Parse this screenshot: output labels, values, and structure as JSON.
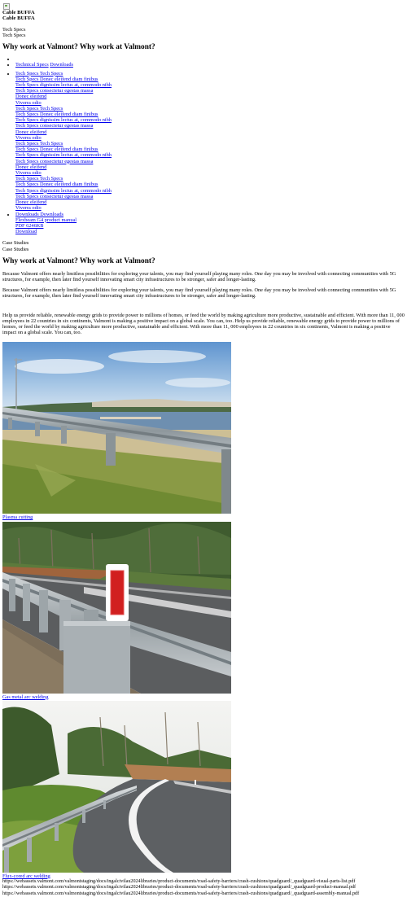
{
  "logo_icon": "broken-image-icon",
  "product": {
    "title_a": "Cable BUFFA",
    "title_b": "Cable BUFFA"
  },
  "tech_specs_heading": {
    "a": "Tech Specs",
    "b": "Tech Specs"
  },
  "section1": {
    "heading": "Why work at Valmont? Why work at Valmont?"
  },
  "tabs": [
    {
      "label": "Technical Specs"
    },
    {
      "label": "Downloads"
    }
  ],
  "spec_groups": [
    {
      "title": "Tech Specs Tech Specs",
      "items": [
        "Tech Specs Donec eleifend diam finibus",
        "Tech Specs dignissim lectus at, commodo nibh",
        "Tech Specs consectetur egestas massa",
        "Donec eleifend",
        "Viverra odio"
      ]
    },
    {
      "title": "Tech Specs Tech Specs",
      "items": [
        "Tech Specs Donec eleifend diam finibus",
        "Tech Specs dignissim lectus at, commodo nibh",
        "Tech Specs consectetur egestas massa",
        "Donec eleifend",
        "Viverra odio"
      ]
    },
    {
      "title": "Tech Specs Tech Specs",
      "items": [
        "Tech Specs Donec eleifend diam finibus",
        "Tech Specs dignissim lectus at, commodo nibh",
        "Tech Specs consectetur egestas massa",
        "Donec eleifend",
        "Viverra odio"
      ]
    },
    {
      "title": "Tech Specs Tech Specs",
      "items": [
        "Tech Specs Donec eleifend diam finibus",
        "Tech Specs dignissim lectus at, commodo nibh",
        "Tech Specs consectetur egestas massa",
        "Donec eleifend",
        "Viverra odio"
      ]
    }
  ],
  "downloads": {
    "title": "Downloads Downloads",
    "file_name": "Flexbeam G4 product manual",
    "file_meta": "PDF 6246KB",
    "action": "Download"
  },
  "case_studies": {
    "a": "Case Studies",
    "b": "Case Studies"
  },
  "section2": {
    "heading": "Why work at Valmont? Why work at Valmont?",
    "paragraph_1": "Because Valmont offers nearly limitless possibilities for exploring your talents, you may find yourself playing many roles. One day you may be involved with connecting communities with 5G structures, for example, then later find yourself innovating smart city infrastructures to be stronger, safer and longer-lasting.",
    "paragraph_2": "Because Valmont offers nearly limitless possibilities for exploring your talents, you may find yourself playing many roles. One day you may be involved with connecting communities with 5G structures, for example, then later find yourself innovating smart city infrastructures to be stronger, safer and longer-lasting.",
    "paragraph_3": "Help us provide reliable, renewable energy grids to provide power to millions of homes, or feed the world by making agriculture more productive, sustainable and efficient. With more than 11, 000 employees in 22 countries in six continents, Valmont is making a positive impact on a global scale. You can, too. Help us provide reliable, renewable energy grids to provide power to millions of homes, or feed the world by making agriculture more productive, sustainable and efficient. With more than 11, 000 employees in 22 countries in six continents, Valmont is making a positive impact on a global scale. You can, too."
  },
  "gallery": [
    {
      "caption": "Plasma cutting",
      "scene": "guardrail-coastal-road"
    },
    {
      "caption": "Gas metal arc welding",
      "scene": "guardrail-end-terminal-red-marker"
    },
    {
      "caption": "Flux-cored arc welding",
      "scene": "guardrail-curved-road-forest"
    }
  ],
  "urls": [
    "https://webassets.valmont.com/valmontstaging/docs/ingalcivilau2024libraries/product-documents/road-safety-barriers/crash-cushions/quadguard/_quadguard-visual-parts-list.pdf",
    "https://webassets.valmont.com/valmontstaging/docs/ingalcivilau2024libraries/product-documents/road-safety-barriers/crash-cushions/quadguard/_quadguard-product-manual.pdf",
    "https://webassets.valmont.com/valmontstaging/docs/ingalcivilau2024libraries/product-documents/road-safety-barriers/crash-cushions/quadguard/_quadguard-assembly-manual.pdf"
  ],
  "colors": {
    "link": "#0000ee",
    "text": "#000000",
    "background": "#ffffff"
  }
}
